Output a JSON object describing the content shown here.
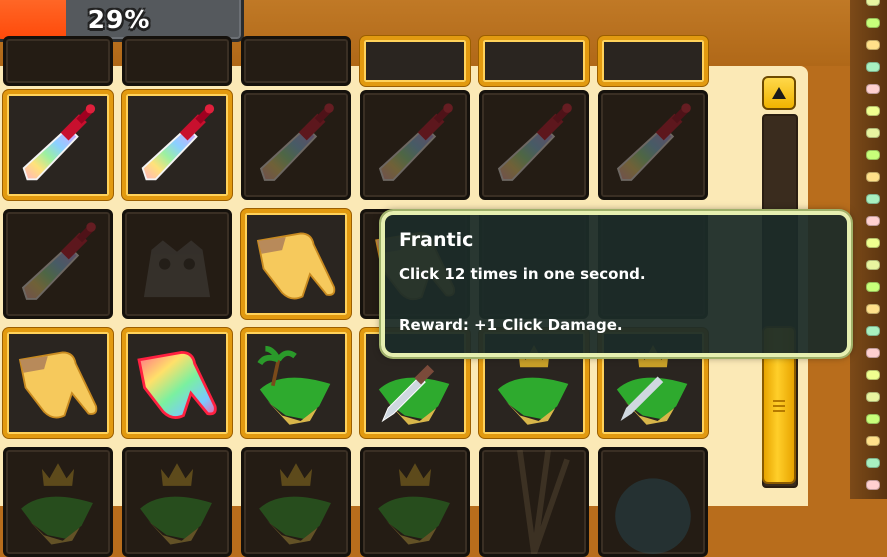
{
  "progress": {
    "label": "29%",
    "percent": 29,
    "fill_color": "#ff5a14"
  },
  "tooltip": {
    "title": "Frantic",
    "description": "Click 12 times in one second.",
    "reward": "Reward: +1 Click Damage."
  },
  "achievement_grid": {
    "rows": [
      [
        "sword-icon:earned",
        "sword-icon:earned",
        "sword-icon:locked",
        "sword-icon:locked",
        "sword-icon:locked",
        "sword-icon:locked"
      ],
      [
        "sword-icon:locked",
        "monster-icon:locked",
        "hand-icon:earned",
        "hand-icon:hidden",
        "blank:hidden",
        "blank:hidden"
      ],
      [
        "hand-icon:earned",
        "rainbow-hand-icon:earned",
        "island-icon:earned",
        "island-sword-icon:earned",
        "island-crown-icon:earned",
        "island-crown-sword-icon:earned"
      ],
      [
        "island-crown-icon:locked",
        "island-crown-icon:locked",
        "island-crown-icon:locked",
        "island-crown-icon:locked",
        "rays-icon:locked",
        "bubble-icon:locked"
      ]
    ]
  },
  "colors": {
    "panel": "#fbe9b6",
    "frame": "#b86d1c",
    "earned_border": "#e29a10",
    "tooltip_bg": "#1c2c28"
  }
}
